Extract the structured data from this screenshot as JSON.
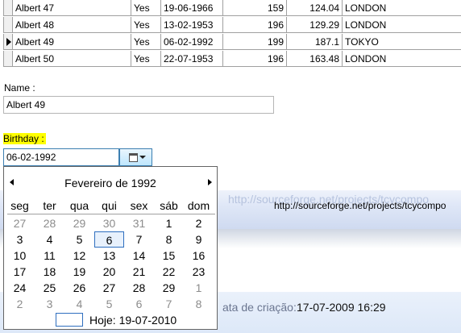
{
  "grid": {
    "rows": [
      {
        "name": "Albert 47",
        "married": "Yes",
        "birth": "19-06-1966",
        "qty": "159",
        "value": "124.04",
        "city": "LONDON",
        "current": false
      },
      {
        "name": "Albert 48",
        "married": "Yes",
        "birth": "13-02-1953",
        "qty": "196",
        "value": "129.29",
        "city": "LONDON",
        "current": false
      },
      {
        "name": "Albert 49",
        "married": "Yes",
        "birth": "06-02-1992",
        "qty": "199",
        "value": "187.1",
        "city": "TOKYO",
        "current": true
      },
      {
        "name": "Albert 50",
        "married": "Yes",
        "birth": "22-07-1953",
        "qty": "196",
        "value": "163.48",
        "city": "LONDON",
        "current": false
      }
    ]
  },
  "form": {
    "name_label": "Name :",
    "name_value": "Albert 49",
    "birthday_label": "Birthday  :",
    "birthday_value": "06-02-1992"
  },
  "calendar": {
    "title": "Fevereiro de 1992",
    "weekdays": [
      "seg",
      "ter",
      "qua",
      "qui",
      "sex",
      "sáb",
      "dom"
    ],
    "weeks": [
      [
        "27",
        "28",
        "29",
        "30",
        "31",
        "1",
        "2"
      ],
      [
        "3",
        "4",
        "5",
        "6",
        "7",
        "8",
        "9"
      ],
      [
        "10",
        "11",
        "12",
        "13",
        "14",
        "15",
        "16"
      ],
      [
        "17",
        "18",
        "19",
        "20",
        "21",
        "22",
        "23"
      ],
      [
        "24",
        "25",
        "26",
        "27",
        "28",
        "29",
        "1"
      ],
      [
        "2",
        "3",
        "4",
        "5",
        "6",
        "7",
        "8"
      ]
    ],
    "selected": "6",
    "today_label": "Hoje: 19-07-2010"
  },
  "background": {
    "url_ghost": "http://sourceforge.net/projects/tcycompo",
    "url": "http://sourceforge.net/projects/tcycompo",
    "date_label": "ata de criação:",
    "date_value": "17-07-2009 16:29"
  }
}
